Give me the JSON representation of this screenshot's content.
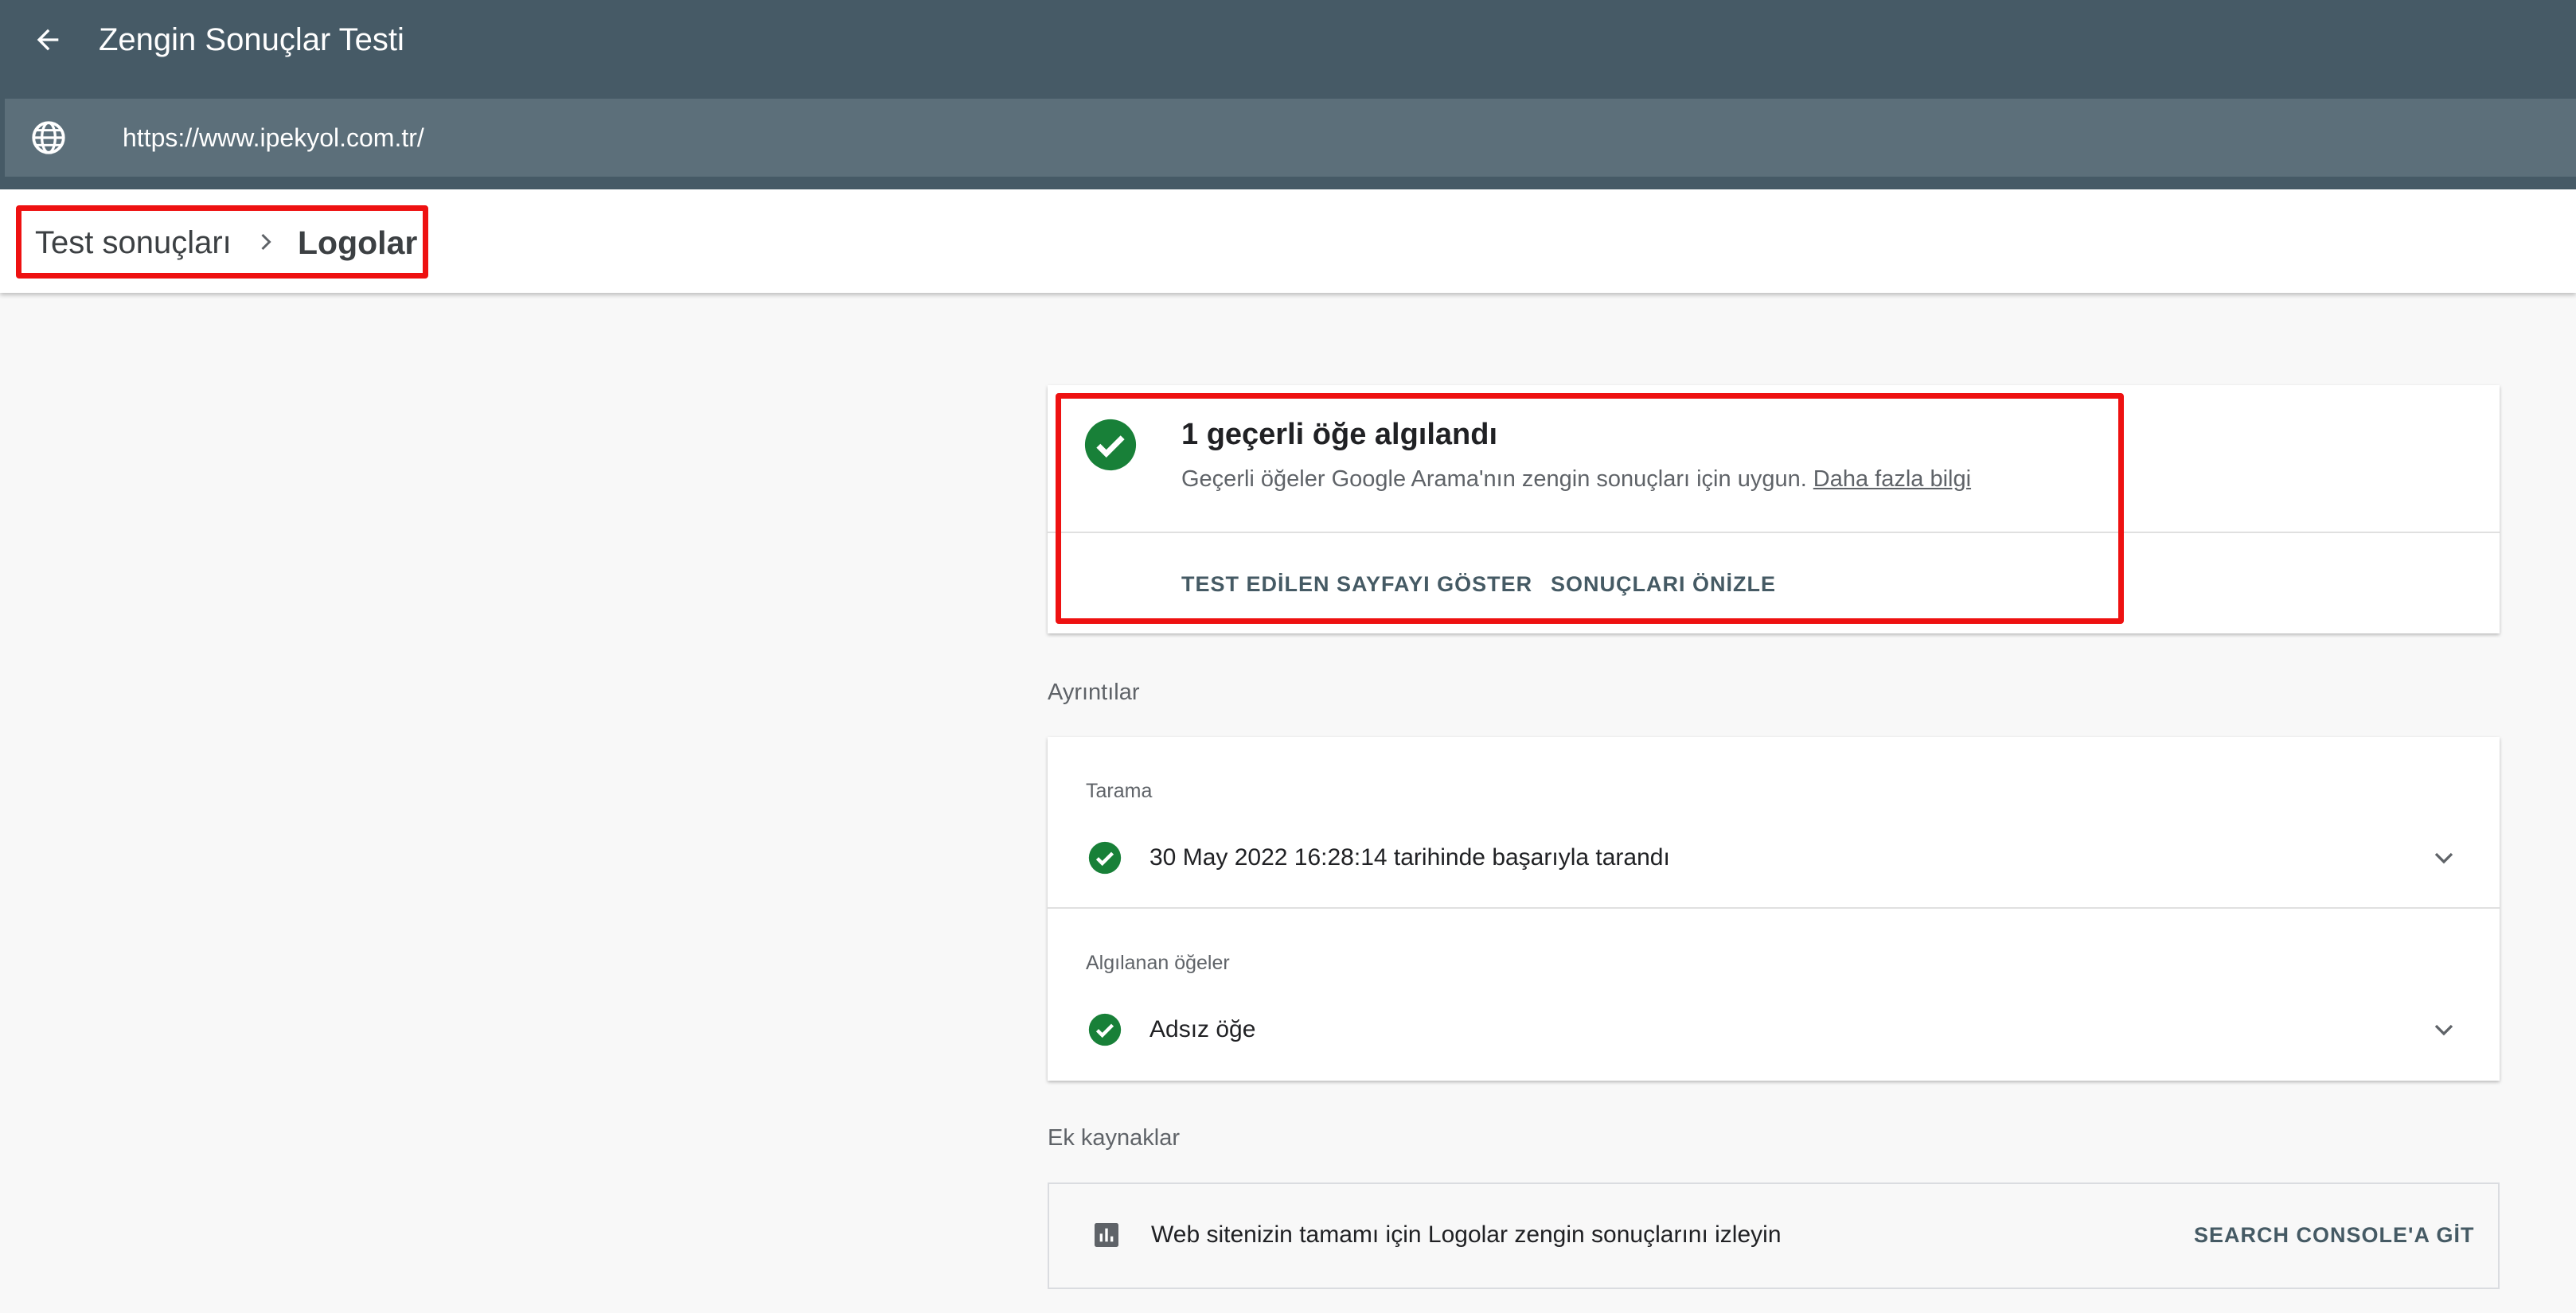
{
  "app": {
    "title": "Zengin Sonuçlar Testi",
    "url": "https://www.ipekyol.com.tr/"
  },
  "breadcrumb": {
    "parent": "Test sonuçları",
    "current": "Logolar"
  },
  "status": {
    "title": "1 geçerli öğe algılandı",
    "description": "Geçerli öğeler Google Arama'nın zengin sonuçları için uygun.",
    "learn_more": "Daha fazla bilgi",
    "actions": [
      "TEST EDİLEN SAYFAYI GÖSTER",
      "SONUÇLARI ÖNİZLE"
    ]
  },
  "details": {
    "heading": "Ayrıntılar",
    "rows": [
      {
        "label": "Tarama",
        "value": "30 May 2022 16:28:14 tarihinde başarıyla tarandı"
      },
      {
        "label": "Algılanan öğeler",
        "value": "Adsız öğe"
      }
    ]
  },
  "resources": {
    "heading": "Ek kaynaklar",
    "text": "Web sitenizin tamamı için Logolar zengin sonuçlarını izleyin",
    "action": "SEARCH CONSOLE'A GİT"
  },
  "colors": {
    "appbar": "#465a66",
    "urlbar": "#5c6f7a",
    "success": "#188038",
    "highlight": "#ee1111"
  },
  "icons": [
    "back-arrow-icon",
    "globe-icon",
    "chevron-right-icon",
    "check-circle-icon",
    "chevron-down-icon",
    "bar-chart-icon"
  ]
}
